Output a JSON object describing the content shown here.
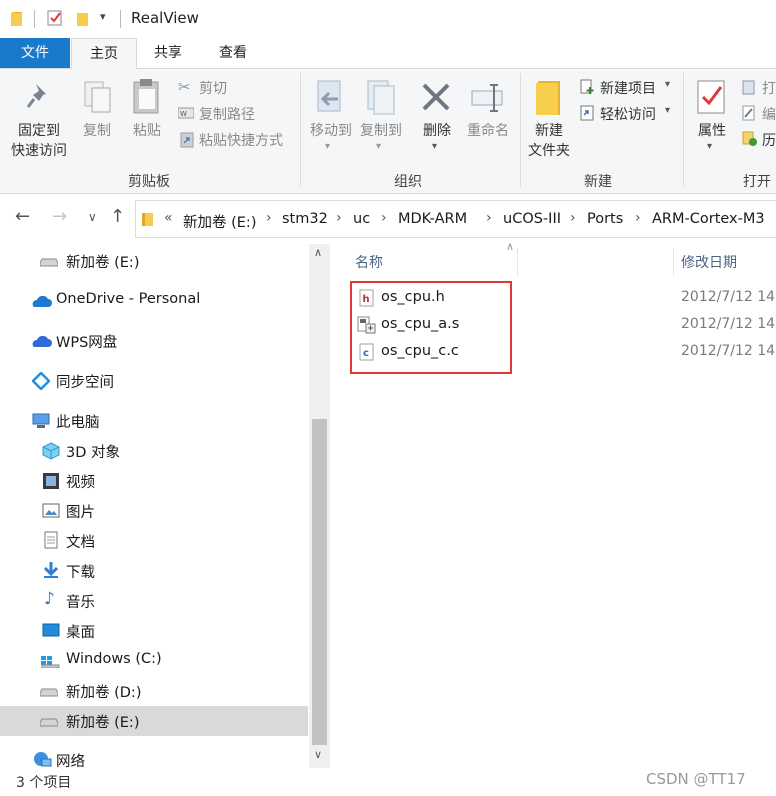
{
  "window": {
    "title": "RealView"
  },
  "tabs": {
    "file": "文件",
    "home": "主页",
    "share": "共享",
    "view": "查看"
  },
  "ribbon": {
    "clipboard": {
      "pin_label_1": "固定到",
      "pin_label_2": "快速访问",
      "copy": "复制",
      "paste": "粘贴",
      "cut": "剪切",
      "copy_path": "复制路径",
      "paste_shortcut": "粘贴快捷方式",
      "group": "剪贴板"
    },
    "organize": {
      "move_to": "移动到",
      "copy_to": "复制到",
      "delete": "删除",
      "rename": "重命名",
      "group": "组织"
    },
    "new": {
      "new_folder_1": "新建",
      "new_folder_2": "文件夹",
      "new_item": "新建项目",
      "easy_access": "轻松访问",
      "group": "新建"
    },
    "open": {
      "properties": "属性",
      "open_partial": "打",
      "edit_partial": "编",
      "history_partial": "历",
      "group": "打开"
    }
  },
  "breadcrumb": {
    "overflow": "«",
    "items": [
      "新加卷 (E:)",
      "stm32",
      "uc",
      "MDK-ARM",
      "uCOS-III",
      "Ports",
      "ARM-Cortex-M3"
    ]
  },
  "nav": {
    "items": [
      {
        "label": "新加卷 (E:)",
        "icon": "drive-icon"
      },
      {
        "label": "OneDrive - Personal",
        "icon": "onedrive-icon"
      },
      {
        "label": "WPS网盘",
        "icon": "wps-cloud-icon"
      },
      {
        "label": "同步空间",
        "icon": "sync-space-icon"
      },
      {
        "label": "此电脑",
        "icon": "this-pc-icon"
      },
      {
        "label": "3D 对象",
        "icon": "3d-objects-icon"
      },
      {
        "label": "视频",
        "icon": "video-icon"
      },
      {
        "label": "图片",
        "icon": "pictures-icon"
      },
      {
        "label": "文档",
        "icon": "documents-icon"
      },
      {
        "label": "下载",
        "icon": "download-icon"
      },
      {
        "label": "音乐",
        "icon": "music-icon"
      },
      {
        "label": "桌面",
        "icon": "desktop-icon"
      },
      {
        "label": "Windows (C:)",
        "icon": "windows-drive-icon"
      },
      {
        "label": "新加卷 (D:)",
        "icon": "drive-icon"
      },
      {
        "label": "新加卷 (E:)",
        "icon": "drive-icon",
        "selected": true
      },
      {
        "label": "网络",
        "icon": "network-icon"
      }
    ]
  },
  "columns": {
    "name": "名称",
    "modified": "修改日期"
  },
  "files": [
    {
      "name": "os_cpu.h",
      "modified": "2012/7/12 14",
      "icon": "h-file-icon"
    },
    {
      "name": "os_cpu_a.s",
      "modified": "2012/7/12 14",
      "icon": "asm-file-icon"
    },
    {
      "name": "os_cpu_c.c",
      "modified": "2012/7/12 14",
      "icon": "c-file-icon"
    }
  ],
  "status": {
    "count": "3 个项目"
  },
  "watermark": "CSDN @TT17",
  "colors": {
    "accent": "#1979ca",
    "highlight_box": "#e0373b",
    "selected_nav": "#d9d9d9"
  }
}
